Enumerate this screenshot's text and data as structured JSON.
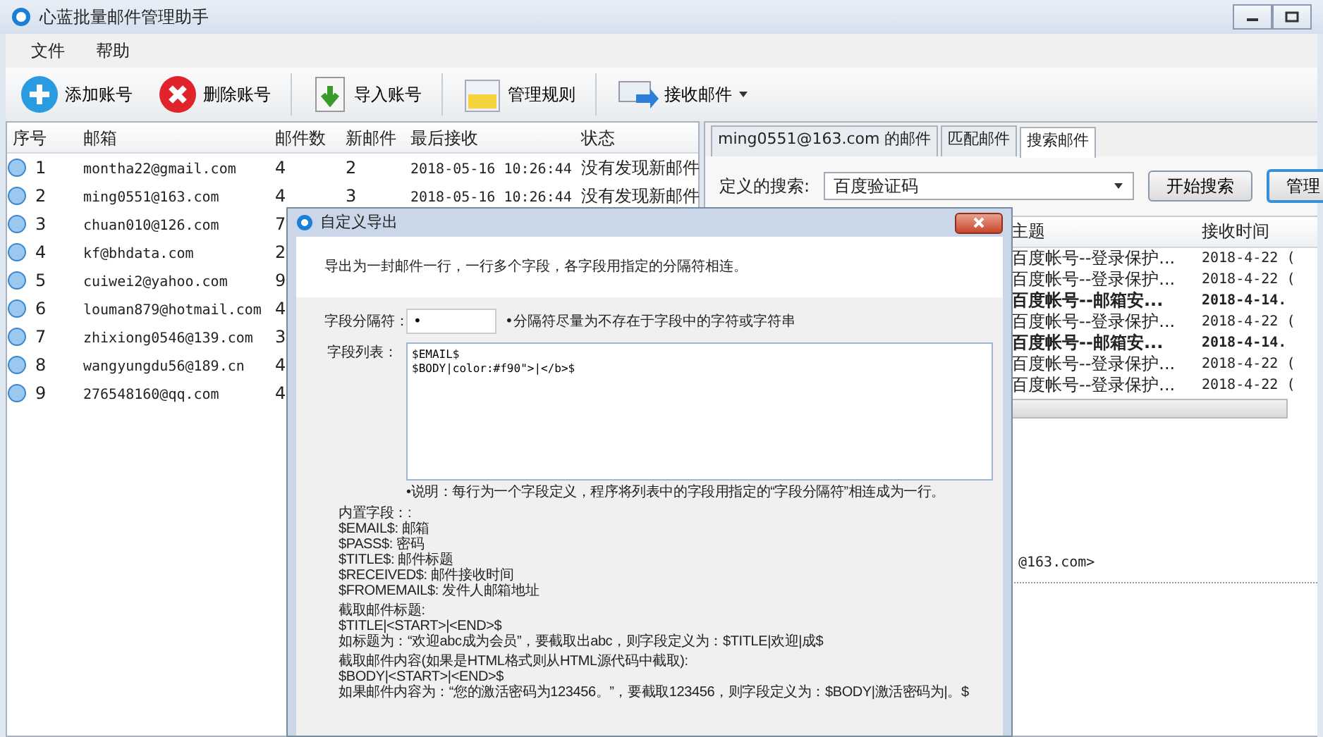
{
  "window": {
    "title": "心蓝批量邮件管理助手"
  },
  "menu": [
    "文件",
    "帮助"
  ],
  "toolbar": [
    {
      "label": "添加账号",
      "kind": "add",
      "dropdown": false
    },
    {
      "label": "删除账号",
      "kind": "delete",
      "dropdown": false
    },
    {
      "label": "导入账号",
      "kind": "import",
      "dropdown": false
    },
    {
      "label": "管理规则",
      "kind": "rules",
      "dropdown": false
    },
    {
      "label": "接收邮件",
      "kind": "receive",
      "dropdown": true
    }
  ],
  "accounts": {
    "columns": [
      "序号",
      "邮箱",
      "邮件数",
      "新邮件",
      "最后接收",
      "状态"
    ],
    "rows": [
      {
        "index": "1",
        "email": "montha22@gmail.com",
        "count": "4",
        "new": "2",
        "last": "2018-05-16 10:26:44",
        "status": "没有发现新邮件"
      },
      {
        "index": "2",
        "email": "ming0551@163.com",
        "count": "4",
        "new": "3",
        "last": "2018-05-16 10:26:44",
        "status": "没有发现新邮件"
      },
      {
        "index": "3",
        "email": "chuan010@126.com",
        "count": "7"
      },
      {
        "index": "4",
        "email": "kf@bhdata.com",
        "count": "2"
      },
      {
        "index": "5",
        "email": "cuiwei2@yahoo.com",
        "count": "9"
      },
      {
        "index": "6",
        "email": "louman879@hotmail.com",
        "count": "4"
      },
      {
        "index": "7",
        "email": "zhixiong0546@139.com",
        "count": "3"
      },
      {
        "index": "8",
        "email": "wangyungdu56@189.cn",
        "count": "4"
      },
      {
        "index": "9",
        "email": "276548160@qq.com",
        "count": "4"
      }
    ]
  },
  "tabs": [
    {
      "label": "ming0551@163.com 的邮件",
      "selected": false
    },
    {
      "label": "匹配邮件",
      "selected": false
    },
    {
      "label": "搜索邮件",
      "selected": true
    }
  ],
  "search": {
    "label": "定义的搜索:",
    "value": "百度验证码",
    "buttons": [
      "开始搜索",
      "管理"
    ]
  },
  "results": {
    "columns": [
      "主题",
      "接收时间"
    ],
    "rows": [
      {
        "subject": "百度帐号--登录保护...",
        "time": "2018-4-22 (",
        "unread": false
      },
      {
        "subject": "百度帐号--登录保护...",
        "time": "2018-4-22 (",
        "unread": false
      },
      {
        "subject": "百度帐号--邮箱安...",
        "time": "2018-4-14.",
        "unread": true
      },
      {
        "subject": "百度帐号--登录保护...",
        "time": "2018-4-22 (",
        "unread": false
      },
      {
        "subject": "百度帐号--邮箱安...",
        "time": "2018-4-14.",
        "unread": true
      },
      {
        "subject": "百度帐号--登录保护...",
        "time": "2018-4-22 (",
        "unread": false
      },
      {
        "subject": "百度帐号--登录保护...",
        "time": "2018-4-22 (",
        "unread": false
      }
    ]
  },
  "preview_text": "@163.com>",
  "dialog": {
    "title": "自定义导出",
    "description": "导出为一封邮件一行，一行多个字段，各字段用指定的分隔符相连。",
    "separator_label": "字段分隔符：",
    "separator_value": "•",
    "separator_hint": "•分隔符尽量为不存在于字段中的字符或字符串",
    "fields_label": "字段列表：",
    "fields_value": "$EMAIL$\n$BODY|color:#f90\">|</b>$",
    "note": "•说明：每行为一个字段定义，程序将列表中的字段用指定的“字段分隔符”相连成为一行。",
    "help_sections": [
      [
        "内置字段：:",
        "$EMAIL$: 邮箱",
        "$PASS$:  密码",
        "$TITLE$: 邮件标题",
        "$RECEIVED$: 邮件接收时间",
        "$FROMEMAIL$: 发件人邮箱地址"
      ],
      [
        "截取邮件标题:",
        "$TITLE|<START>|<END>$",
        "如标题为：“欢迎abc成为会员”，要截取出abc，则字段定义为：$TITLE|欢迎|成$"
      ],
      [
        "截取邮件内容(如果是HTML格式则从HTML源代码中截取):",
        "$BODY|<START>|<END>$",
        "如果邮件内容为：“您的激活密码为123456。”，要截取123456，则字段定义为：$BODY|激活密码为|。$"
      ]
    ]
  }
}
